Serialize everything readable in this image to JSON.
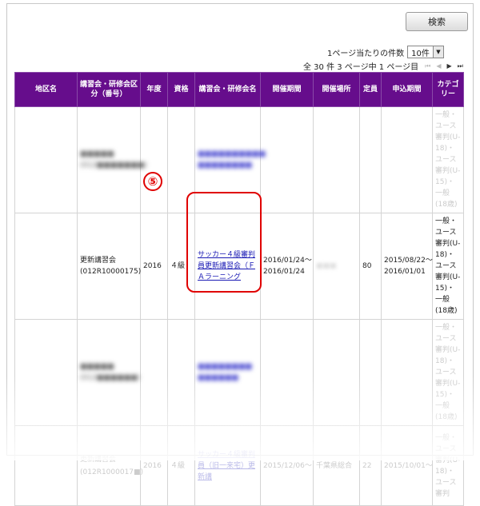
{
  "search_button": "検索",
  "per_page": {
    "label": "1ページ当たりの件数",
    "value": "10件",
    "arrow": "▼"
  },
  "pagination": {
    "summary": "全 30 件 3 ページ中 1 ページ目",
    "first": "⏮",
    "prev": "◀",
    "next": "▶",
    "last": "⏭"
  },
  "columns": [
    "地区名",
    "講習会・研修会区分（番号）",
    "年度",
    "資格",
    "講習会・研修会名",
    "開催期間",
    "開催場所",
    "定員",
    "申込期間",
    "カテゴリー"
  ],
  "rows": [
    {
      "area": "",
      "division": "■■■■■",
      "division_no": "(012■■■■■■■)",
      "year": "",
      "grade": "",
      "title": "■■■■■■■■■■ ■■■■■■■■",
      "period": "",
      "place": "",
      "capacity": "",
      "apply": "",
      "category": "一般・ユース審判(U-18)・ユース審判(U-15)・一般(18歳)"
    },
    {
      "area": "",
      "division": "更新講習会",
      "division_no": "(012R10000175)",
      "year": "2016",
      "grade": "４級",
      "title": "サッカー４級審判員更新講習会（ＦＡラーニング",
      "period_start": "2016/01/24〜",
      "period_end": "2016/01/24",
      "place": "■■■",
      "capacity": "80",
      "apply_start": "2015/08/22〜",
      "apply_end": "2016/01/01",
      "category": "一般・ユース審判(U-18)・ユース審判(U-15)・一般(18歳)"
    },
    {
      "area": "",
      "division": "■■■■■",
      "division_no": "(012■■■■■■)",
      "year": "",
      "grade": "",
      "title": "■■■■■■■■ ■■■■■■",
      "period": "",
      "place": "",
      "capacity": "",
      "apply": "",
      "category": "一般・ユース審判(U-18)・ユース審判(U-15)・一般(18歳)"
    },
    {
      "area": "",
      "division": "更新講習会",
      "division_no": "(012R1000017■)",
      "year": "2016",
      "grade": "４級",
      "title": "サッカー４級審判員（旧一来宅）更新講",
      "period": "2015/12/06〜",
      "place": "千葉県総合",
      "capacity": "22",
      "apply": "2015/10/01〜",
      "category": "一般・ユース審判(U-18)・ユース審判"
    }
  ],
  "annotation": {
    "number": "⑤"
  }
}
